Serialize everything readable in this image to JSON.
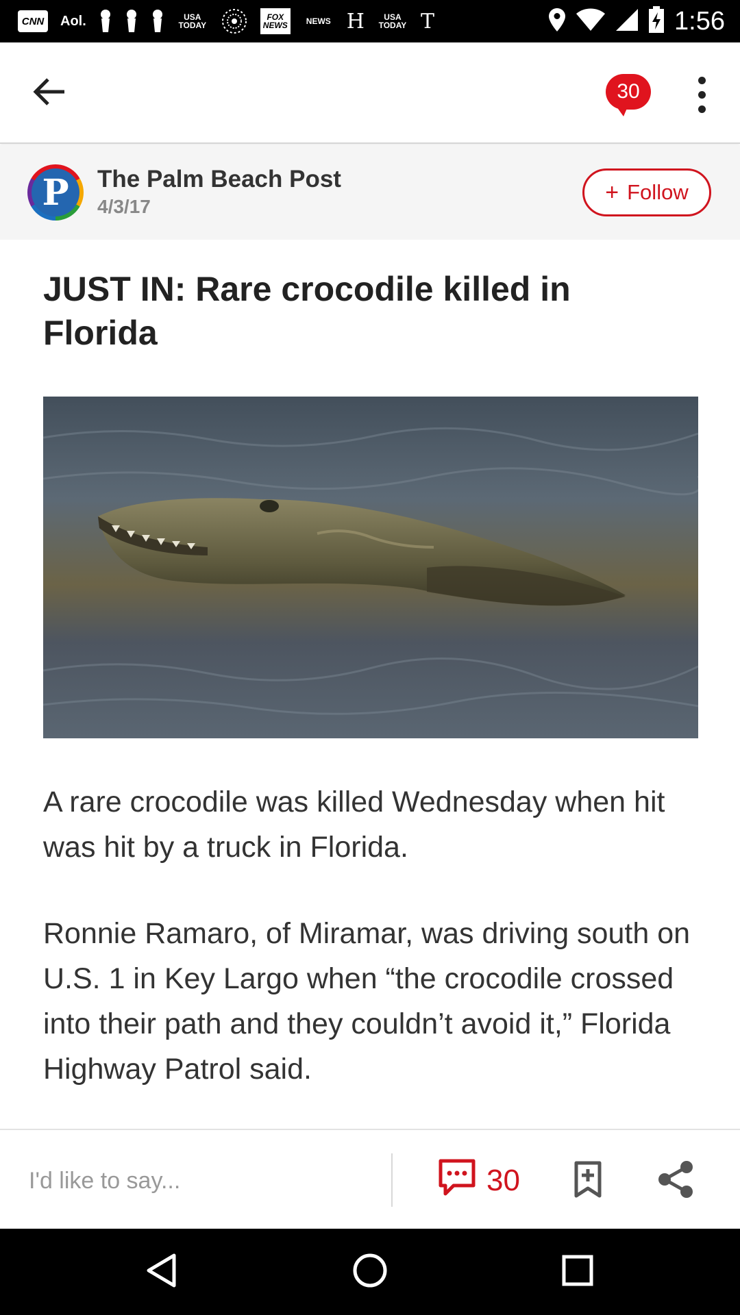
{
  "status_bar": {
    "time": "1:56",
    "notification_icons": [
      {
        "name": "cnn-icon",
        "text": "CNN",
        "style": "cnn"
      },
      {
        "name": "aol-icon",
        "text": "Aol.",
        "style": "aol"
      },
      {
        "name": "pin-icon",
        "text": "",
        "style": "pin"
      },
      {
        "name": "pin-icon",
        "text": "",
        "style": "pin"
      },
      {
        "name": "pin-icon",
        "text": "",
        "style": "pin"
      },
      {
        "name": "usa-today-icon",
        "text": "USA TODAY",
        "style": "small"
      },
      {
        "name": "news-globe-icon",
        "text": "",
        "style": "globe"
      },
      {
        "name": "fox-news-icon",
        "text": "FOX NEWS",
        "style": "box"
      },
      {
        "name": "nbc-news-icon",
        "text": "NEWS",
        "style": "small"
      },
      {
        "name": "huffpost-icon",
        "text": "H",
        "style": "serif"
      },
      {
        "name": "usa-today-icon",
        "text": "USA TODAY",
        "style": "small"
      },
      {
        "name": "nyt-icon",
        "text": "T",
        "style": "serif"
      }
    ]
  },
  "app_bar": {
    "comment_count": "30"
  },
  "publisher": {
    "name": "The Palm Beach Post",
    "date": "4/3/17",
    "logo_letter": "P",
    "follow_label": "Follow",
    "follow_plus": "+"
  },
  "article": {
    "headline": "JUST IN: Rare crocodile killed in Florida",
    "image_subject": "crocodile swimming in water",
    "paragraphs": [
      "A rare crocodile was killed Wednesday when hit was hit by a truck in Florida.",
      "Ronnie Ramaro, of Miramar, was driving south on U.S. 1 in Key Largo when “the crocodile crossed into their path and they couldn’t avoid it,” Florida Highway Patrol said."
    ]
  },
  "action_bar": {
    "comment_placeholder": "I'd like to say...",
    "comment_count": "30"
  },
  "colors": {
    "accent": "#d0141e",
    "badge": "#e0141e",
    "status_bar": "#000000",
    "nav_bar": "#000000"
  }
}
